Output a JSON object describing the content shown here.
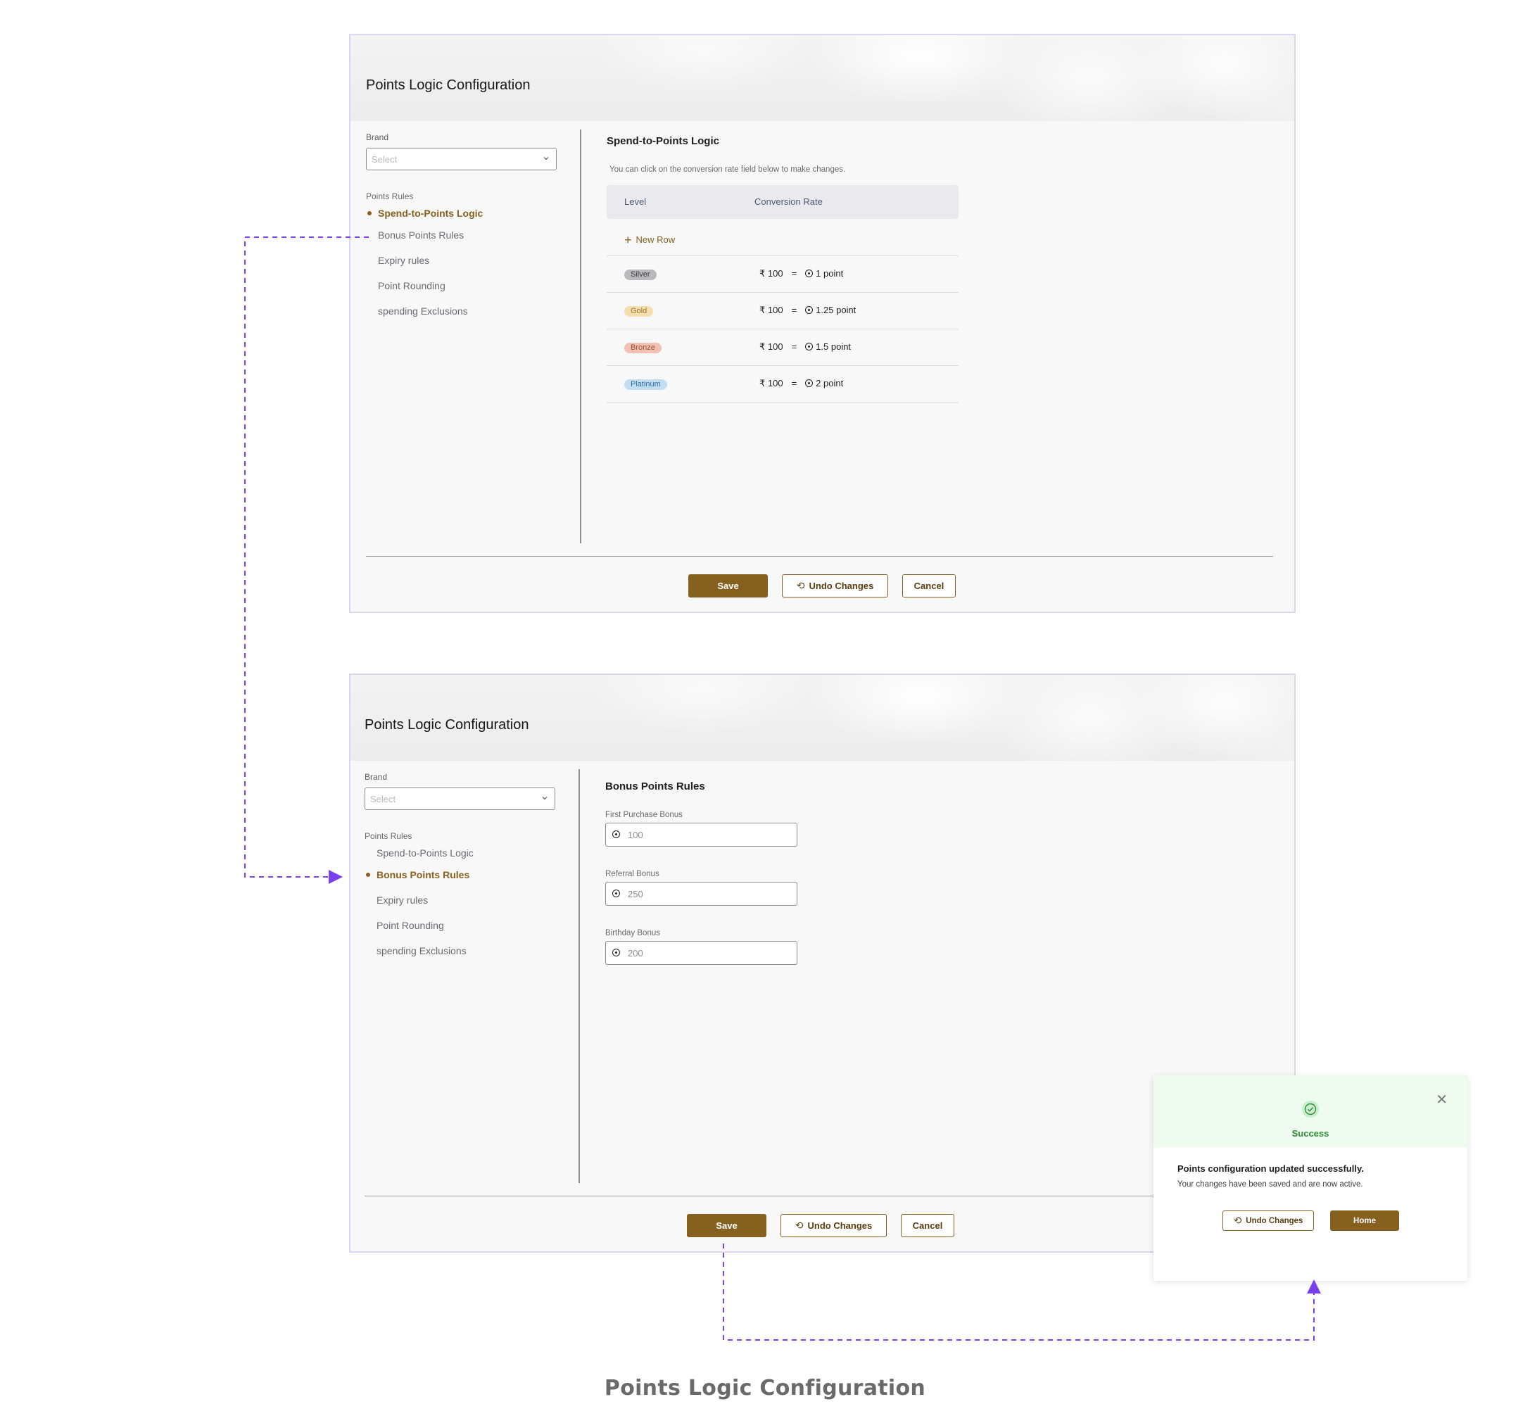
{
  "screen1": {
    "title": "Points Logic Configuration",
    "brand_label": "Brand",
    "brand_placeholder": "Select",
    "rules_label": "Points Rules",
    "rules": [
      "Spend-to-Points Logic",
      "Bonus Points Rules",
      "Expiry rules",
      "Point Rounding",
      "spending Exclusions"
    ],
    "active_rule": "Spend-to-Points Logic",
    "section_title": "Spend-to-Points Logic",
    "hint": "You can click on the conversion rate field below to make changes.",
    "table": {
      "headers": [
        "Level",
        "Conversion Rate"
      ],
      "new_row": "New Row",
      "rows": [
        {
          "level": "Silver",
          "spend": "₹ 100",
          "eq": "=",
          "points": "1 point",
          "color": "#b9b9bd"
        },
        {
          "level": "Gold",
          "spend": "₹ 100",
          "eq": "=",
          "points": "1.25 point",
          "color": "#f6dfaf"
        },
        {
          "level": "Bronze",
          "spend": "₹ 100",
          "eq": "=",
          "points": "1.5 point",
          "color": "#f1c2b4"
        },
        {
          "level": "Platinum",
          "spend": "₹ 100",
          "eq": "=",
          "points": "2 point",
          "color": "#c3def2"
        }
      ]
    },
    "buttons": {
      "save": "Save",
      "undo": "Undo Changes",
      "cancel": "Cancel"
    }
  },
  "screen2": {
    "title": "Points Logic Configuration",
    "brand_label": "Brand",
    "brand_placeholder": "Select",
    "rules_label": "Points Rules",
    "rules": [
      "Spend-to-Points Logic",
      "Bonus Points Rules",
      "Expiry rules",
      "Point Rounding",
      "spending Exclusions"
    ],
    "active_rule": "Bonus Points Rules",
    "section_title": "Bonus Points Rules",
    "fields": [
      {
        "label": "First Purchase Bonus",
        "value": "100"
      },
      {
        "label": "Referral Bonus",
        "value": "250"
      },
      {
        "label": "Birthday Bonus",
        "value": "200"
      }
    ],
    "buttons": {
      "save": "Save",
      "undo": "Undo Changes",
      "cancel": "Cancel"
    }
  },
  "modal": {
    "status": "Success",
    "title": "Points configuration updated successfully.",
    "message": "Your changes have been saved and are now active.",
    "undo_label": "Undo Changes",
    "home_label": "Home"
  },
  "footer_title": "Points Logic Configuration",
  "colors": {
    "accent": "#86601e",
    "flow_arrow": "#7b3ff2",
    "success": "#2d8a35"
  }
}
